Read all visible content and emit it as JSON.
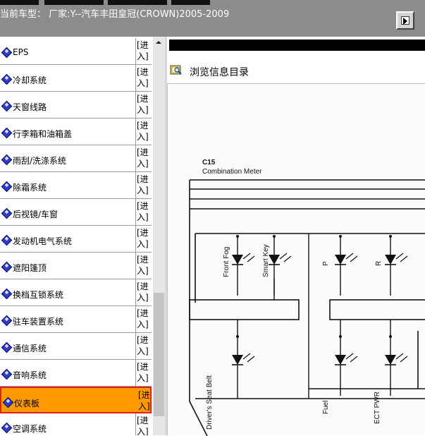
{
  "header": {
    "title": "当前车型： 厂家:Y--汽车丰田皇冠(CROWN)2005-2009",
    "nav_icon": "arrow-right-icon"
  },
  "sidebar": {
    "enter_label": "[进入]",
    "items": [
      {
        "label": "EPS"
      },
      {
        "label": "冷却系统"
      },
      {
        "label": "天窗线路"
      },
      {
        "label": "行李箱和油箱盖"
      },
      {
        "label": "雨刮/洗涤系统"
      },
      {
        "label": "除霜系统"
      },
      {
        "label": "后视镜/车窗"
      },
      {
        "label": "发动机电气系统"
      },
      {
        "label": "遮阳篷顶"
      },
      {
        "label": "换档互锁系统"
      },
      {
        "label": "驻车装置系统"
      },
      {
        "label": "通信系统"
      },
      {
        "label": "音响系统"
      },
      {
        "label": "仪表板",
        "selected": true
      },
      {
        "label": "空调系统"
      }
    ],
    "selected_color": "#ff9900",
    "selected_border": "#e0201a"
  },
  "content": {
    "browse_label": "浏览信息目录",
    "browse_icon": "book-search-icon"
  },
  "diagram": {
    "connector": "C15",
    "title": "Combination Meter",
    "top_labels": [
      "Front Fog",
      "Smart Key",
      "P",
      "R"
    ],
    "bottom_labels": [
      "Driver's Seat Belt",
      "Fuel",
      "ECT PWR"
    ],
    "line_color": "#111111"
  }
}
